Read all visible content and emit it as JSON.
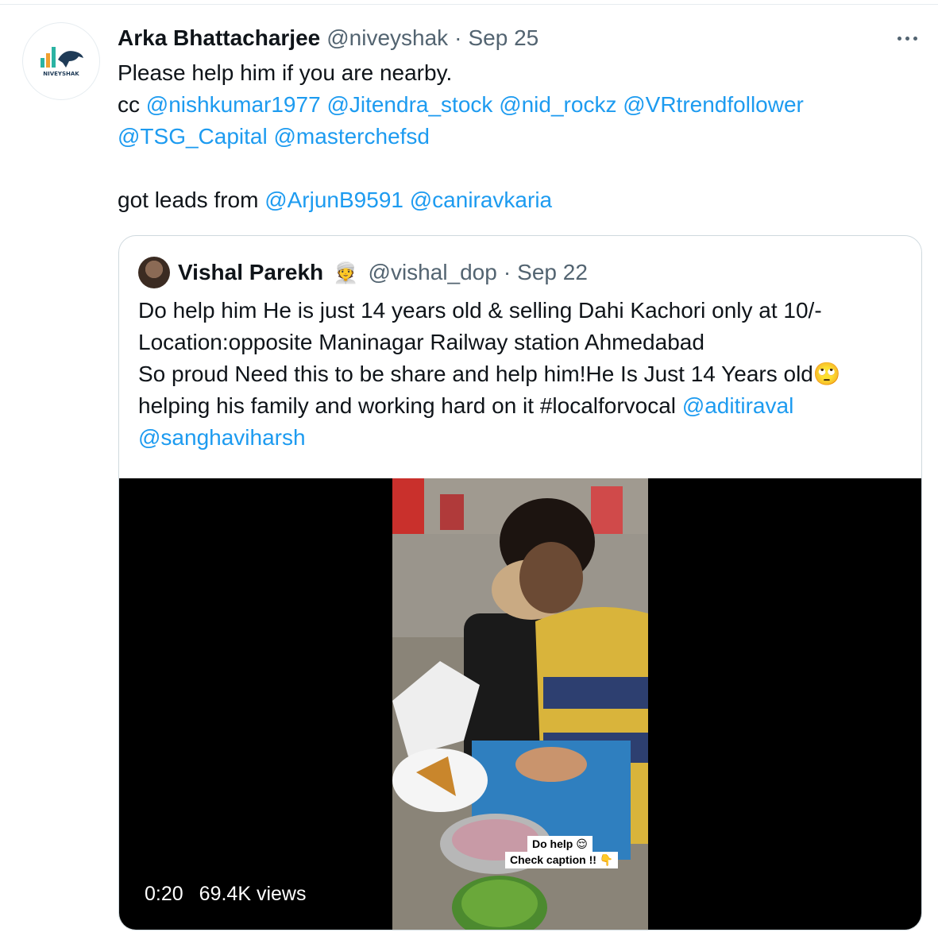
{
  "tweet": {
    "author_name": "Arka Bhattacharjee",
    "author_handle": "@niveyshak",
    "separator": "·",
    "date": "Sep 25",
    "avatar_text": "NIVEYSHAK",
    "avatar_icon": "bull-chart-logo",
    "more_icon": "more-dots-icon",
    "line1": "Please help him if you are nearby.",
    "cc_prefix": "cc",
    "mentions_line2": [
      "@nishkumar1977",
      "@Jitendra_stock",
      "@nid_rockz",
      "@VRtrendfollower"
    ],
    "mentions_line3": [
      "@TSG_Capital",
      "@masterchefsd"
    ],
    "leads_prefix": "got leads from",
    "leads_mentions": [
      "@ArjunB9591",
      "@caniravkaria"
    ]
  },
  "quote": {
    "author_name": "Vishal Parekh",
    "badge_emoji": "👳",
    "author_handle": "@vishal_dop",
    "separator": "·",
    "date": "Sep 22",
    "line1": "Do help him He is just 14 years old & selling Dahi Kachori only at 10/-",
    "line2": "Location:opposite Maninagar Railway station Ahmedabad",
    "line3": "So proud Need this to be share and help him!He Is Just 14 Years old",
    "line3_emoji": "🙄",
    "line4_text": "helping his family and working hard on it #localforvocal",
    "line4_mention": "@aditiraval",
    "line5_mention": "@sanghaviharsh"
  },
  "video": {
    "duration": "0:20",
    "views": "69.4K views",
    "sticker_line1": "Do help 😌",
    "sticker_line2": "Check caption !! 👇"
  },
  "colors": {
    "mention": "#1d9bf0",
    "secondary_text": "#536471",
    "border": "#cfd9de"
  }
}
